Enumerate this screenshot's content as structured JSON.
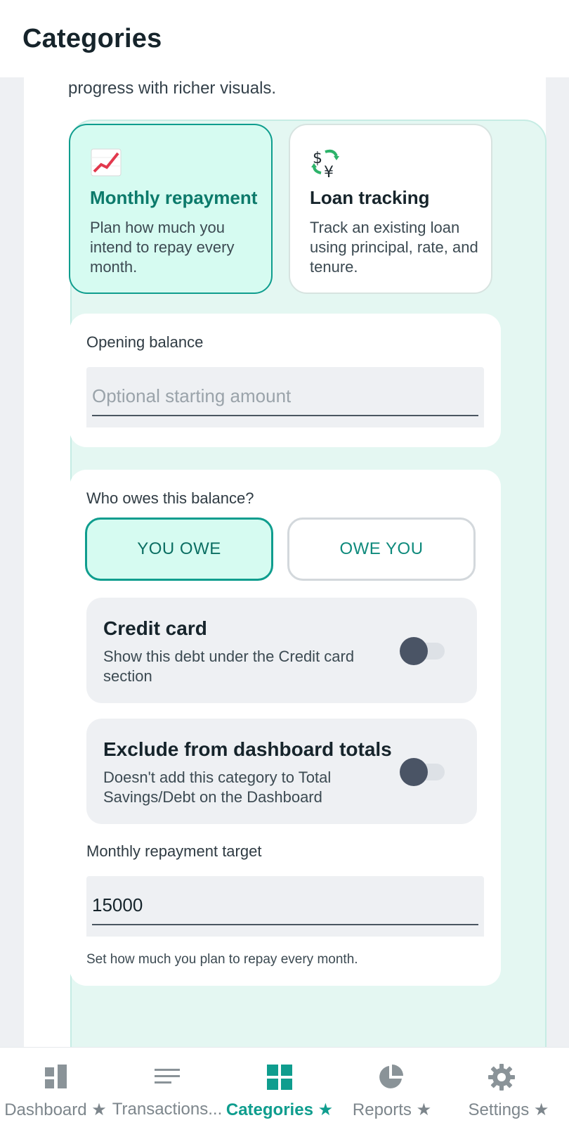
{
  "appbar": {
    "title": "Categories"
  },
  "intro_text": "progress with richer visuals.",
  "modes": [
    {
      "icon": "chart-up-icon",
      "title": "Monthly repayment",
      "desc": "Plan how much you intend to repay every month.",
      "selected": true
    },
    {
      "icon": "currency-exchange-icon",
      "title": "Loan tracking",
      "desc": "Track an existing loan using principal, rate, and tenure.",
      "selected": false
    }
  ],
  "opening_balance": {
    "label": "Opening balance",
    "placeholder": "Optional starting amount",
    "value": ""
  },
  "owes": {
    "question": "Who owes this balance?",
    "options": [
      {
        "label": "YOU OWE",
        "selected": true
      },
      {
        "label": "OWE YOU",
        "selected": false
      }
    ]
  },
  "credit_card": {
    "title": "Credit card",
    "desc": "Show this debt under the Credit card section",
    "enabled": false
  },
  "exclude": {
    "title": "Exclude from dashboard totals",
    "desc": "Doesn't add this category to Total Savings/Debt on the Dashboard",
    "enabled": false
  },
  "target": {
    "label": "Monthly repayment target",
    "value": "15000",
    "helper": "Set how much you plan to repay every month."
  },
  "nav": [
    {
      "icon": "dashboard-icon",
      "label": "Dashboard ★",
      "active": false
    },
    {
      "icon": "transactions-icon",
      "label": "Transactions...",
      "active": false
    },
    {
      "icon": "categories-icon",
      "label": "Categories ★",
      "active": true
    },
    {
      "icon": "reports-icon",
      "label": "Reports ★",
      "active": false
    },
    {
      "icon": "settings-icon",
      "label": "Settings ★",
      "active": false
    }
  ],
  "colors": {
    "accent": "#0f9d8e",
    "card_bg": "#e4f7f2",
    "selected_bg": "#d6fbf1"
  }
}
